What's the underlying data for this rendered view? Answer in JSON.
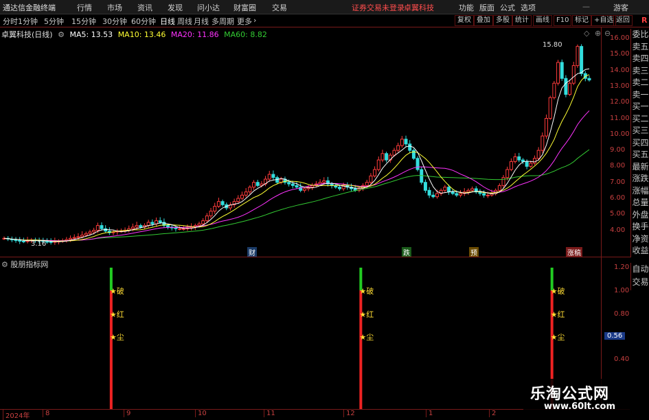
{
  "menubar": {
    "logo": "通达信金融终端",
    "items": [
      "行情",
      "市场",
      "资讯",
      "发现",
      "问小达",
      "财富圈",
      "交易"
    ],
    "warning": "证券交易未登录",
    "stock_name": "卓翼科技",
    "right_items": [
      "功能",
      "版面",
      "公式",
      "选项"
    ],
    "guest": "游客"
  },
  "toolbar": {
    "periods": [
      "分时",
      "1分钟",
      "5分钟",
      "15分钟",
      "30分钟",
      "60分钟",
      "日线",
      "周线",
      "月线",
      "多周期",
      "更多"
    ],
    "active_period": "日线",
    "right_buttons": [
      "复权",
      "叠加",
      "多股",
      "统计",
      "画线",
      "F10",
      "标记",
      "+自选",
      "返回"
    ]
  },
  "legend": {
    "title": "卓翼科技(日线)",
    "ma5": "MA5: 13.53",
    "ma10": "MA10: 13.46",
    "ma20": "MA20: 11.86",
    "ma60": "MA60: 8.82",
    "colors": {
      "ma5": "#ffffff",
      "ma10": "#ffff33",
      "ma20": "#ff33ff",
      "ma60": "#33cc33"
    }
  },
  "price_axis": [
    "16.00",
    "15.00",
    "14.00",
    "13.00",
    "12.00",
    "11.00",
    "10.00",
    "9.00",
    "8.00",
    "7.00",
    "6.00",
    "5.00",
    "4.00"
  ],
  "annotations": {
    "high": "15.80",
    "low": "3.16"
  },
  "event_tags": [
    "财",
    "跌",
    "预",
    "涨稿"
  ],
  "side_panel": [
    "委比",
    "卖五",
    "卖四",
    "卖三",
    "卖二",
    "卖一",
    "买一",
    "买二",
    "买三",
    "买四",
    "买五",
    "最新",
    "涨跌",
    "涨幅",
    "总量",
    "外盘",
    "换手",
    "净资",
    "收益"
  ],
  "side_panel2": [
    "自动",
    "交易"
  ],
  "indicator": {
    "title": "股朋指标网",
    "axis": [
      "1.20",
      "1.00",
      "0.80",
      "0.56",
      "0.40"
    ],
    "current_value": "0.56",
    "labels": [
      "★破",
      "★红",
      "★尘"
    ]
  },
  "date_axis": [
    "2024年",
    "8",
    "9",
    "10",
    "11",
    "12",
    "1",
    "2"
  ],
  "brand": {
    "title": "乐淘公式网",
    "url": "www.60lt.com"
  },
  "chart_data": {
    "type": "candlestick",
    "title": "卓翼科技(日线)",
    "ylim": [
      3.16,
      16.3
    ],
    "high": 15.8,
    "low": 3.16,
    "closes": [
      3.5,
      3.45,
      3.4,
      3.38,
      3.32,
      3.3,
      3.35,
      3.4,
      3.38,
      3.35,
      3.3,
      3.28,
      3.25,
      3.3,
      3.32,
      3.35,
      3.42,
      3.5,
      3.55,
      3.6,
      3.7,
      3.8,
      3.9,
      4.0,
      4.3,
      4.1,
      3.95,
      3.85,
      3.9,
      3.95,
      3.95,
      4.0,
      4.1,
      4.2,
      4.3,
      4.2,
      4.3,
      4.5,
      4.4,
      4.6,
      4.5,
      4.3,
      4.2,
      4.15,
      4.1,
      4.1,
      4.1,
      4.15,
      4.2,
      4.3,
      4.4,
      4.6,
      4.9,
      5.2,
      5.5,
      5.8,
      5.6,
      5.4,
      5.6,
      5.8,
      6.0,
      6.2,
      6.4,
      6.7,
      7.0,
      6.8,
      6.9,
      7.2,
      7.5,
      7.3,
      7.0,
      7.2,
      7.0,
      6.9,
      6.8,
      6.7,
      6.5,
      6.6,
      6.7,
      6.8,
      6.9,
      7.0,
      7.1,
      6.9,
      6.8,
      6.7,
      6.6,
      6.8,
      6.7,
      6.6,
      6.5,
      6.6,
      6.8,
      7.0,
      7.4,
      7.8,
      8.4,
      8.8,
      8.4,
      8.7,
      9.0,
      9.3,
      9.7,
      9.4,
      9.0,
      8.5,
      7.8,
      7.0,
      6.5,
      6.2,
      6.1,
      6.3,
      6.5,
      6.7,
      6.4,
      6.3,
      6.2,
      6.3,
      6.4,
      6.5,
      6.6,
      6.4,
      6.3,
      6.2,
      6.2,
      6.3,
      6.5,
      6.8,
      7.3,
      7.8,
      8.3,
      8.6,
      8.4,
      8.3,
      8.0,
      8.2,
      8.5,
      9.0,
      9.9,
      11.0,
      12.3,
      13.2,
      14.5,
      13.5,
      12.5,
      13.2,
      14.3,
      15.5,
      13.8,
      13.5,
      13.4
    ],
    "series": [
      {
        "name": "MA5",
        "latest": 13.53
      },
      {
        "name": "MA10",
        "latest": 13.46
      },
      {
        "name": "MA20",
        "latest": 11.86
      },
      {
        "name": "MA60",
        "latest": 8.82
      }
    ],
    "signal_day_index": [
      13,
      77,
      126
    ],
    "signal_rise_share": [
      0.16,
      0.16,
      0.16
    ]
  }
}
